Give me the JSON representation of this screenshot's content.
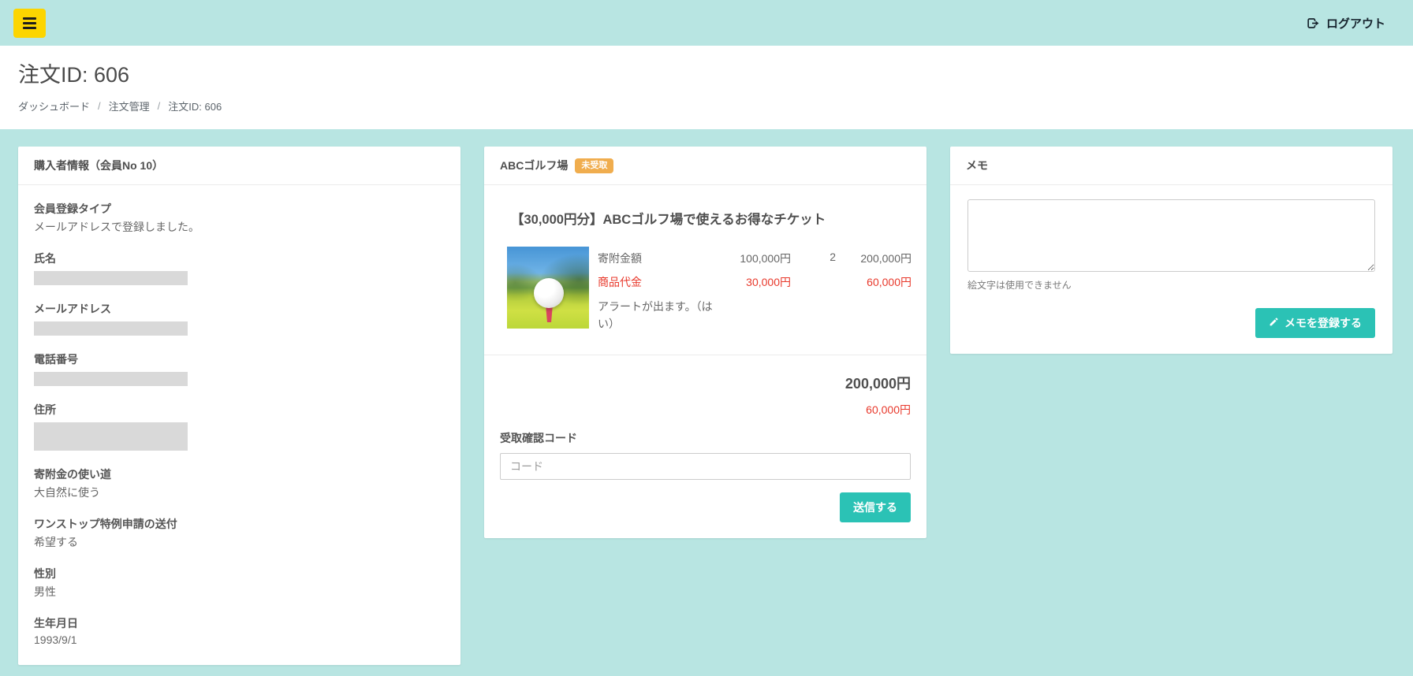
{
  "navbar": {
    "logout_label": "ログアウト"
  },
  "page": {
    "title": "注文ID: 606",
    "breadcrumb_separator": "/",
    "breadcrumb": [
      {
        "label": "ダッシュボード"
      },
      {
        "label": "注文管理"
      },
      {
        "label": "注文ID: 606"
      }
    ]
  },
  "buyer_card": {
    "title": "購入者情報（会員No 10）",
    "fields": [
      {
        "label": "会員登録タイプ",
        "value": "メールアドレスで登録しました。"
      },
      {
        "label": "氏名",
        "value": ""
      },
      {
        "label": "メールアドレス",
        "value": ""
      },
      {
        "label": "電話番号",
        "value": ""
      },
      {
        "label": "住所",
        "value": ""
      },
      {
        "label": "寄附金の使い道",
        "value": "大自然に使う"
      },
      {
        "label": "ワンストップ特例申請の送付",
        "value": "希望する"
      },
      {
        "label": "性別",
        "value": "男性"
      },
      {
        "label": "生年月日",
        "value": "1993/9/1"
      }
    ]
  },
  "order_card": {
    "title": "ABCゴルフ場",
    "badge": "未受取",
    "product_title": "【30,000円分】ABCゴルフ場で使えるお得なチケット",
    "product_image": "golf-ball-on-tee",
    "rows": [
      {
        "label": "寄附金額",
        "unit_price": "100,000円",
        "quantity": "2",
        "line_total": "200,000円"
      },
      {
        "label": "商品代金",
        "unit_price": "30,000円",
        "quantity": "",
        "line_total": "60,000円"
      }
    ],
    "alert_note": "アラートが出ます。（はい）",
    "grand_total": "200,000円",
    "grand_total_red": "60,000円",
    "code_label": "受取確認コード",
    "code_placeholder": "コード",
    "code_value": "",
    "submit_label": "送信する"
  },
  "memo_card": {
    "title": "メモ",
    "textarea_value": "",
    "note": "絵文字は使用できません",
    "button_label": "メモを登録する"
  },
  "colors": {
    "background_teal": "#b8e5e2",
    "accent_teal": "#2bc2b5",
    "badge_orange": "#f0ad4e",
    "alert_red": "#e8392c",
    "hamburger_yellow": "#fcd500",
    "redacted_gray": "#d9d9d9"
  }
}
